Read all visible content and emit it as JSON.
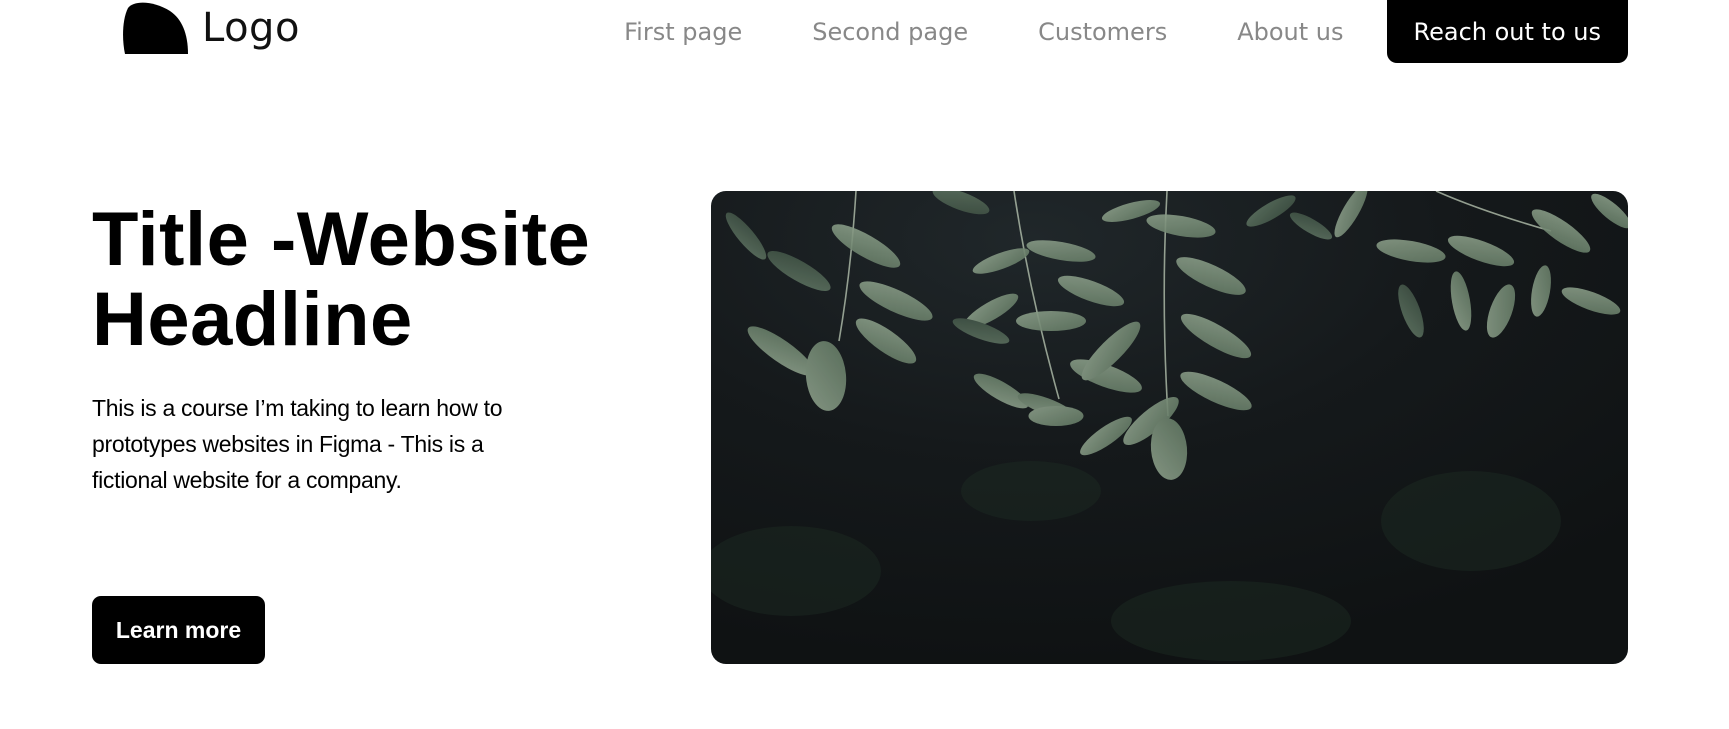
{
  "header": {
    "logo_text": "Logo",
    "logo_icon": "blob-logo-icon",
    "nav": [
      {
        "label": "First page"
      },
      {
        "label": "Second page"
      },
      {
        "label": "Customers"
      },
      {
        "label": "About us"
      }
    ],
    "cta_label": "Reach out to us"
  },
  "hero": {
    "title_line1": "Title -Website",
    "title_line2": "Headline",
    "description": "This is a course I’m taking to learn how to prototypes websites in Figma - This is a fictional website for a company.",
    "button_label": "Learn more",
    "image_subject": "hanging-green-leaves-photo"
  },
  "colors": {
    "accent": "#000000",
    "nav_text": "#888888",
    "background": "#ffffff",
    "image_dark": "#121617",
    "leaf_green": "#7a907a"
  }
}
